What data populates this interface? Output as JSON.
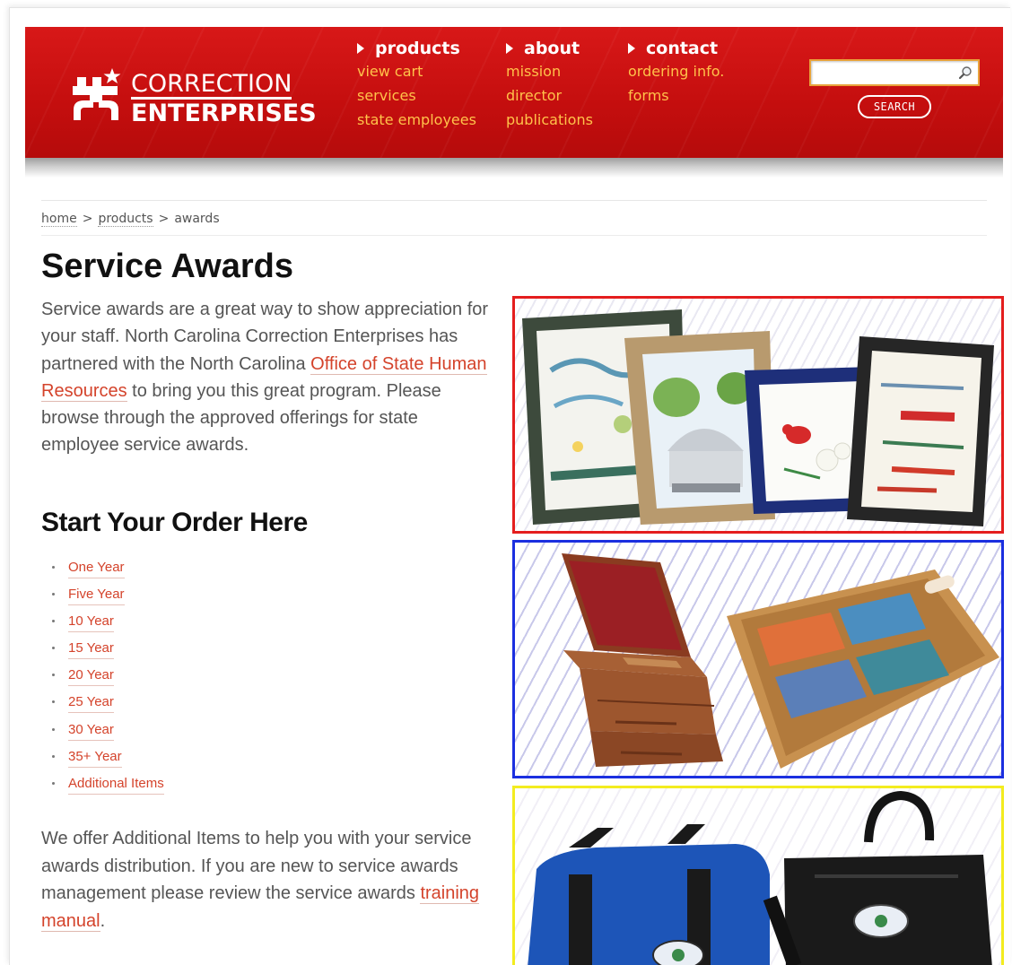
{
  "brand": {
    "line1": "CORRECTION",
    "line2": "ENTERPRISES"
  },
  "nav": {
    "products": {
      "label": "products",
      "links": [
        "view cart",
        "services",
        "state employees"
      ]
    },
    "about": {
      "label": "about",
      "links": [
        "mission",
        "director",
        "publications"
      ]
    },
    "contact": {
      "label": "contact",
      "links": [
        "ordering info.",
        "forms"
      ]
    }
  },
  "search": {
    "value": "",
    "button_label": "SEARCH"
  },
  "breadcrumb": {
    "home": "home",
    "sep1": ">",
    "products": "products",
    "sep2": ">",
    "current": "awards"
  },
  "main": {
    "title": "Service Awards",
    "intro_before": "Service awards are a great way to show appreciation for your staff. North Carolina Correction Enterprises has partnered with the North Carolina ",
    "intro_link": "Office of State Human Resources",
    "intro_after": " to bring you this great program. Please browse through the approved offerings for state employee service awards.",
    "order_title": "Start Your Order Here",
    "order_items": [
      "One Year",
      "Five Year",
      "10 Year",
      "15 Year",
      "20 Year",
      "25 Year",
      "30 Year",
      "35+ Year",
      "Additional Items"
    ],
    "outro_before": "We offer Additional Items to help you with your service awards distribution. If you are new to service awards management please review the service awards ",
    "outro_link": "training manual",
    "outro_after": "."
  },
  "colors": {
    "header_red": "#c40e0e",
    "nav_link_orange": "#ffc24a",
    "content_link": "#d4432b",
    "panel_red": "#e41e1e",
    "panel_blue": "#1b2fe0",
    "panel_yellow": "#f3ec1f"
  },
  "icons": {
    "search": "magnifier-icon",
    "nav_arrow": "triangle-right-icon"
  }
}
